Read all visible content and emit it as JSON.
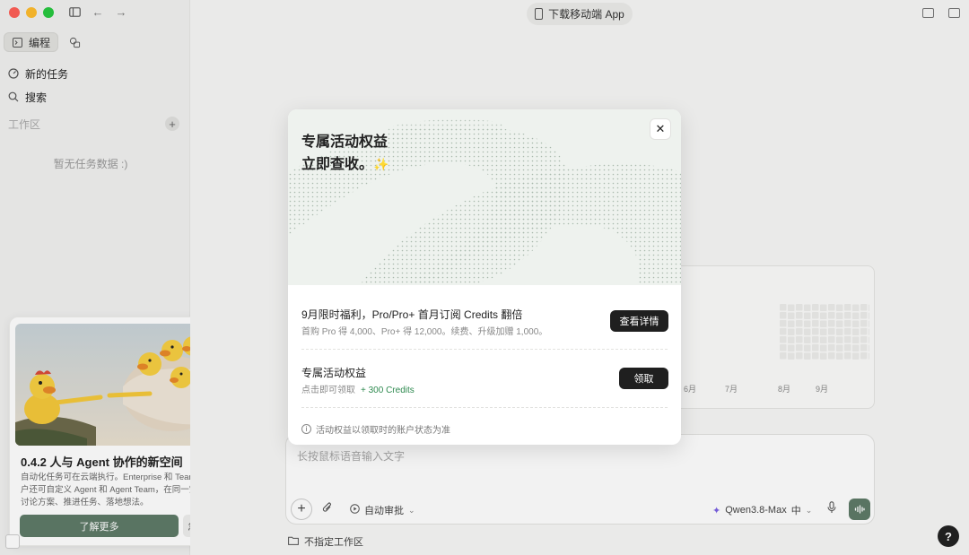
{
  "sidebar": {
    "tabs": [
      {
        "label": "编程",
        "icon": "terminal-icon"
      },
      {
        "label": "",
        "icon": "shapes-icon"
      }
    ],
    "nav": [
      {
        "label": "新的任务",
        "icon": "new-task-icon"
      },
      {
        "label": "搜索",
        "icon": "search-icon"
      }
    ],
    "workspace_label": "工作区",
    "add_symbol": "+",
    "empty_text": "暂无任务数据 :)"
  },
  "update_card": {
    "title": "0.4.2 人与 Agent 协作的新空间",
    "description": "自动化任务可在云端执行。Enterprise 和 Teams 用户还可自定义 Agent 和 Agent Team，在同一空间讨论方案、推进任务、落地想法。",
    "primary_button": "了解更多",
    "secondary_button": "忽略"
  },
  "header": {
    "download_label": "下载移动端 App"
  },
  "heatmap": {
    "months": [
      "6月",
      "7月",
      "8月",
      "9月"
    ]
  },
  "composer": {
    "placeholder": "长按鼠标语音输入文字",
    "auto_approve": "自动审批",
    "model": "Qwen3.8-Max",
    "model_suffix": "中",
    "workspace_picker": "不指定工作区"
  },
  "help_label": "?",
  "modal": {
    "title_line1": "专属活动权益",
    "title_line2": "立即查收。",
    "close_symbol": "✕",
    "offer1": {
      "title": "9月限时福利，Pro/Pro+ 首月订阅 Credits 翻倍",
      "subtitle": "首购 Pro 得 4,000、Pro+ 得 12,000。续费、升级加赠 1,000。",
      "button": "查看详情"
    },
    "offer2": {
      "title": "专属活动权益",
      "subtitle": "点击即可领取",
      "credits": "+ 300 Credits",
      "button": "领取"
    },
    "note": "活动权益以领取时的账户状态为准"
  },
  "colors": {
    "accent_green": "#5e7b68",
    "credit_green": "#2f8a50",
    "dark_button": "#1f1f1f"
  }
}
